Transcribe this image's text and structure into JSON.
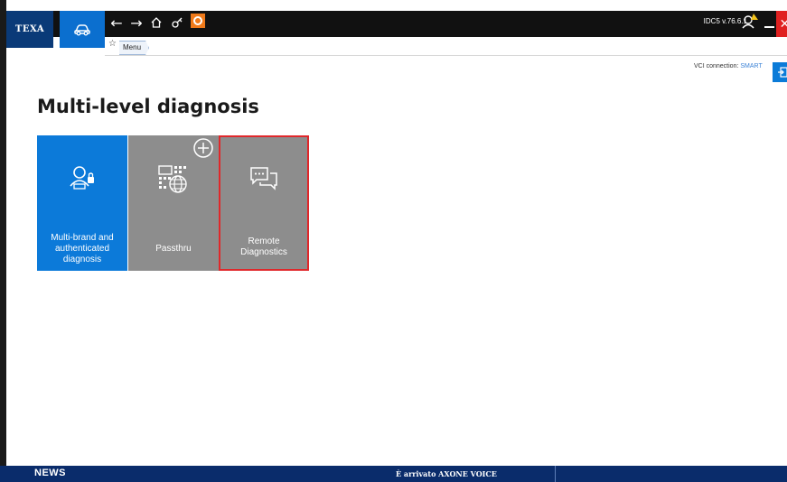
{
  "app": {
    "logo": "TEXA",
    "version": "IDC5 v.76.6.1"
  },
  "breadcrumb": {
    "items": [
      "Menu"
    ]
  },
  "vci": {
    "label": "VCI connection:",
    "value": "SMART"
  },
  "main": {
    "title": "Multi-level diagnosis",
    "tiles": [
      {
        "label_lines": [
          "Multi-brand and",
          "authenticated",
          "diagnosis"
        ],
        "icon": "user-car-lock-icon",
        "color": "#0c7ad9"
      },
      {
        "label_lines": [
          "Passthru"
        ],
        "icon": "network-globe-icon",
        "color": "#8d8d8d"
      },
      {
        "label_lines": [
          "Remote Diagnostics"
        ],
        "icon": "chat-bubbles-icon",
        "color": "#8d8d8d",
        "selected": true
      }
    ]
  },
  "news": {
    "title": "NEWS",
    "text": "È arrivato AXONE VOICE"
  },
  "colors": {
    "brand": "#0a3a78",
    "accent": "#0b6fcf",
    "close": "#e02020",
    "highlight": "#e0282b"
  }
}
